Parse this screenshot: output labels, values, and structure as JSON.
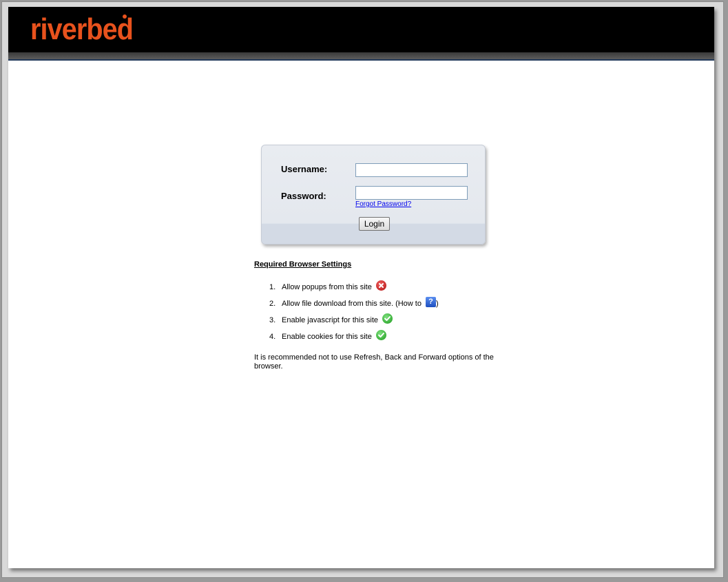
{
  "brand": {
    "name": "riverbed",
    "color": "#e8521d"
  },
  "login": {
    "username_label": "Username:",
    "password_label": "Password:",
    "username_value": "",
    "password_value": "",
    "forgot_link": "Forgot Password?",
    "submit_label": "Login"
  },
  "settings": {
    "title": "Required Browser Settings",
    "items": [
      {
        "num": "1.",
        "text": "Allow popups from this site",
        "status": "error-icon"
      },
      {
        "num": "2.",
        "text": "Allow file download from this site. (How to",
        "suffix": ")",
        "status": "help-icon",
        "help_glyph": "?"
      },
      {
        "num": "3.",
        "text": "Enable javascript for this site",
        "status": "check-icon"
      },
      {
        "num": "4.",
        "text": "Enable cookies for this site",
        "status": "check-icon"
      }
    ],
    "note": "It is recommended not to use Refresh, Back and Forward options of the browser."
  }
}
